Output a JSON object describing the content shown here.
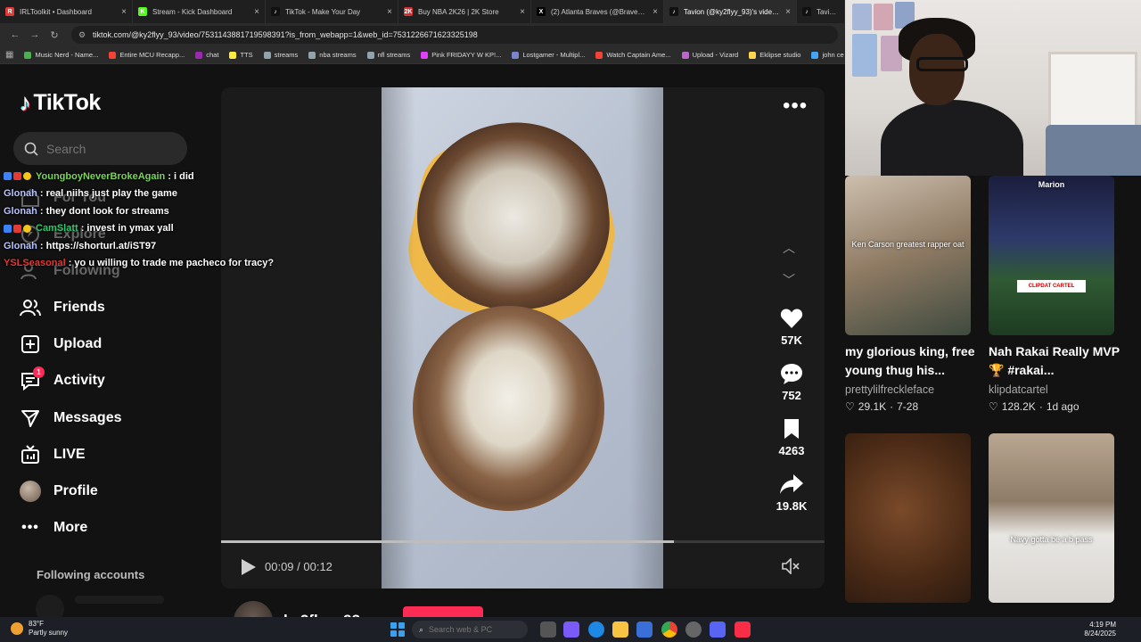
{
  "browser": {
    "tabs": [
      {
        "title": "IRLToolkit • Dashboard",
        "color": "#e53935",
        "glyph": "R"
      },
      {
        "title": "Stream - Kick Dashboard",
        "color": "#53fc18",
        "glyph": "K"
      },
      {
        "title": "TikTok - Make Your Day",
        "color": "#111111",
        "glyph": "♪"
      },
      {
        "title": "Buy NBA 2K26 | 2K Store",
        "color": "#d32f2f",
        "glyph": "2K"
      },
      {
        "title": "(2) Atlanta Braves (@Braves) / X",
        "color": "#000000",
        "glyph": "X"
      },
      {
        "title": "Tavion (@ky2flyy_93)'s video of",
        "color": "#111111",
        "glyph": "♪"
      },
      {
        "title": "Tavion (",
        "color": "#111111",
        "glyph": "♪"
      }
    ],
    "url": "tiktok.com/@ky2flyy_93/video/7531143881719598391?is_from_webapp=1&web_id=7531226671623325198",
    "bookmarks": [
      {
        "label": "Music Nerd - Name...",
        "color": "#4caf50"
      },
      {
        "label": "Entire MCU Recapp...",
        "color": "#f44336"
      },
      {
        "label": "chat",
        "color": "#9c27b0"
      },
      {
        "label": "TTS",
        "color": "#ffeb3b"
      },
      {
        "label": "streams",
        "color": "#90a4ae"
      },
      {
        "label": "nba streams",
        "color": "#90a4ae"
      },
      {
        "label": "nfl streams",
        "color": "#90a4ae"
      },
      {
        "label": "Pink FRIDAYY W KP!...",
        "color": "#e040fb"
      },
      {
        "label": "Lostgamer - Multipl...",
        "color": "#7986cb"
      },
      {
        "label": "Watch Captain Ame...",
        "color": "#f44336"
      },
      {
        "label": "Upload - Vizard",
        "color": "#ba68c8"
      },
      {
        "label": "Eklipse studio",
        "color": "#ffd54f"
      },
      {
        "label": "john ce",
        "color": "#42a5f5"
      }
    ]
  },
  "tiktok": {
    "logo": "TikTok",
    "search_placeholder": "Search",
    "nav": [
      {
        "label": "For You",
        "icon": "home-icon"
      },
      {
        "label": "Explore",
        "icon": "compass-icon"
      },
      {
        "label": "Following",
        "icon": "following-icon"
      },
      {
        "label": "Friends",
        "icon": "friends-icon"
      },
      {
        "label": "Upload",
        "icon": "plus-square-icon"
      },
      {
        "label": "Activity",
        "icon": "activity-icon",
        "badge": "1"
      },
      {
        "label": "Messages",
        "icon": "send-icon"
      },
      {
        "label": "LIVE",
        "icon": "live-tv-icon"
      },
      {
        "label": "Profile",
        "icon": "avatar"
      },
      {
        "label": "More",
        "icon": "more-dots-icon"
      }
    ],
    "following_accounts": "Following accounts",
    "video": {
      "likes": "57K",
      "comments": "752",
      "saves": "4263",
      "shares": "19.8K",
      "time": "00:09 / 00:12",
      "progress": 0.75,
      "author": "ky2flyy_93"
    },
    "related": [
      {
        "caption": "Ken Carson greatest rapper oat",
        "title": "my glorious king, free young thug his...",
        "author": "prettylilfreckleface",
        "likes": "29.1K",
        "date": "7-28"
      },
      {
        "caption": "Marion",
        "overlay": "CLIPDAT CARTEL",
        "title": "Nah Rakai Really MVP 🏆 #rakai...",
        "author": "klipdatcartel",
        "likes": "128.2K",
        "date": "1d ago"
      },
      {
        "caption": "",
        "title": "",
        "author": "",
        "likes": "",
        "date": ""
      },
      {
        "caption": "Navy gotta be a b pass",
        "title": "",
        "author": "",
        "likes": "",
        "date": ""
      }
    ]
  },
  "chat": [
    {
      "user": "YoungboyNeverBrokeAgain",
      "color": "#7cd65a",
      "msg": ": i did",
      "badges": true
    },
    {
      "user": "Glonah",
      "color": "#b8c4ff",
      "msg": ": real niihs just play the game",
      "badges": false
    },
    {
      "user": "Glonah",
      "color": "#b8c4ff",
      "msg": ": they dont look for streams",
      "badges": false
    },
    {
      "user": "CamSlatt",
      "color": "#2ecc71",
      "msg": ": invest in ymax yall",
      "badges": true
    },
    {
      "user": "Glonah",
      "color": "#b8c4ff",
      "msg": ": https://shorturl.at/iST97",
      "badges": false
    },
    {
      "user": "YSLSeasonal",
      "color": "#e53935",
      "msg": ": yo u willing to trade me pacheco for tracy?",
      "badges": false
    }
  ],
  "taskbar": {
    "temp": "83°F",
    "weather": "Partly sunny",
    "search_placeholder": "Search web & PC",
    "time": "4:19 PM",
    "date": "8/24/2025"
  }
}
